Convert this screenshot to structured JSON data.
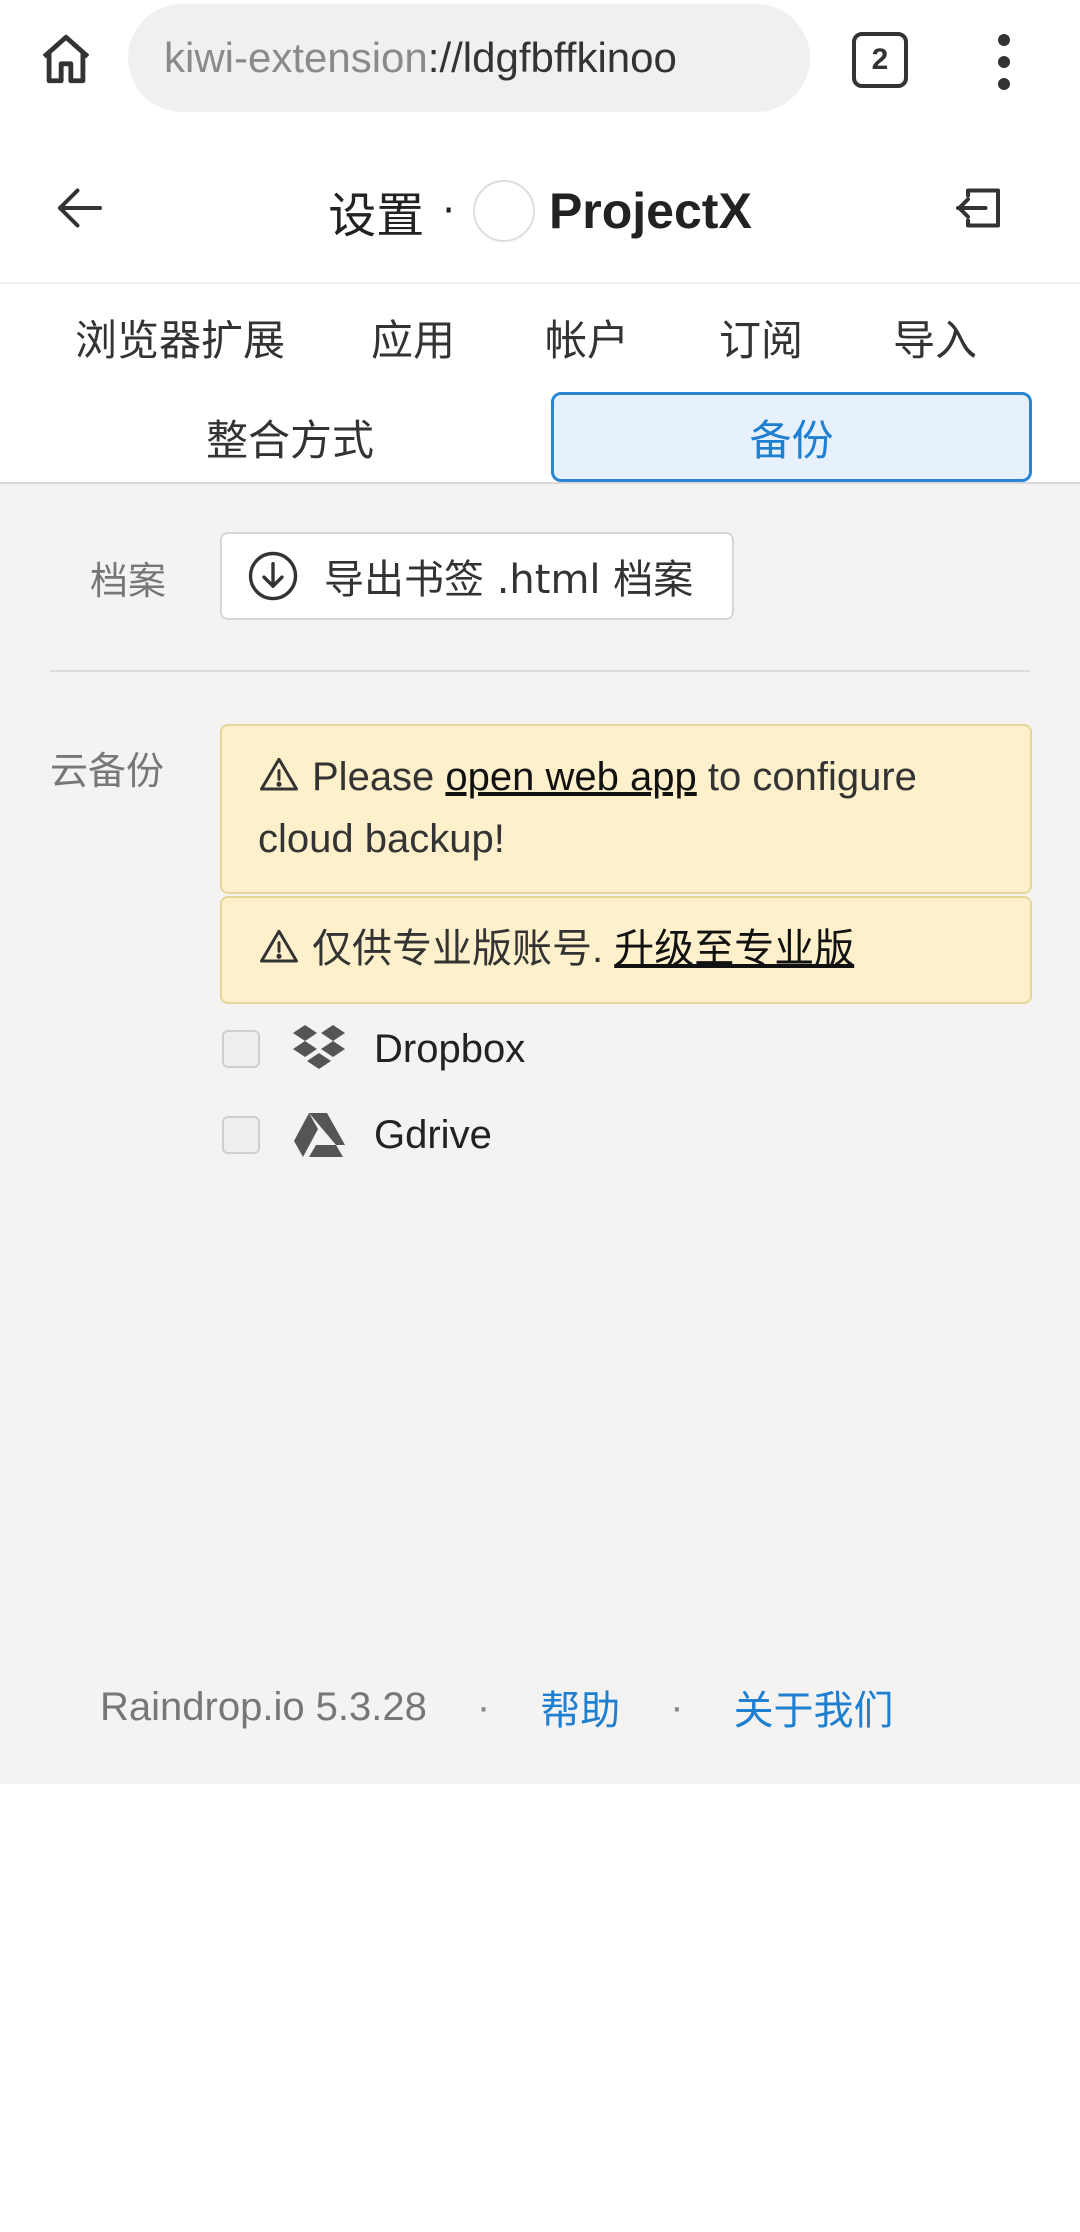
{
  "browser": {
    "url_scheme": "kiwi-extension",
    "url_rest": "://ldgfbffkinoo",
    "tab_count": "2"
  },
  "header": {
    "title": "设置",
    "dot": "·",
    "project": "ProjectX"
  },
  "tabs": {
    "row1": [
      {
        "label": "浏览器扩展"
      },
      {
        "label": "应用"
      },
      {
        "label": "帐户"
      },
      {
        "label": "订阅"
      },
      {
        "label": "导入"
      }
    ],
    "row2": [
      {
        "label": "整合方式",
        "active": false
      },
      {
        "label": "备份",
        "active": true
      }
    ]
  },
  "archive": {
    "label": "档案",
    "export_button": "导出书签 .html 档案"
  },
  "cloud": {
    "label": "云备份",
    "alert1_prefix": "Please ",
    "alert1_link": "open web app",
    "alert1_suffix": " to configure cloud backup!",
    "alert2_text": "仅供专业版账号. ",
    "alert2_link": "升级至专业版",
    "providers": [
      {
        "name": "Dropbox",
        "icon": "dropbox-icon",
        "checked": false
      },
      {
        "name": "Gdrive",
        "icon": "gdrive-icon",
        "checked": false
      }
    ]
  },
  "footer": {
    "version": "Raindrop.io 5.3.28",
    "sep": "·",
    "help": "帮助",
    "about": "关于我们"
  },
  "colors": {
    "accent": "#1f7fd0",
    "alert_bg": "#fdf0cb",
    "content_bg": "#f4f3f2"
  }
}
